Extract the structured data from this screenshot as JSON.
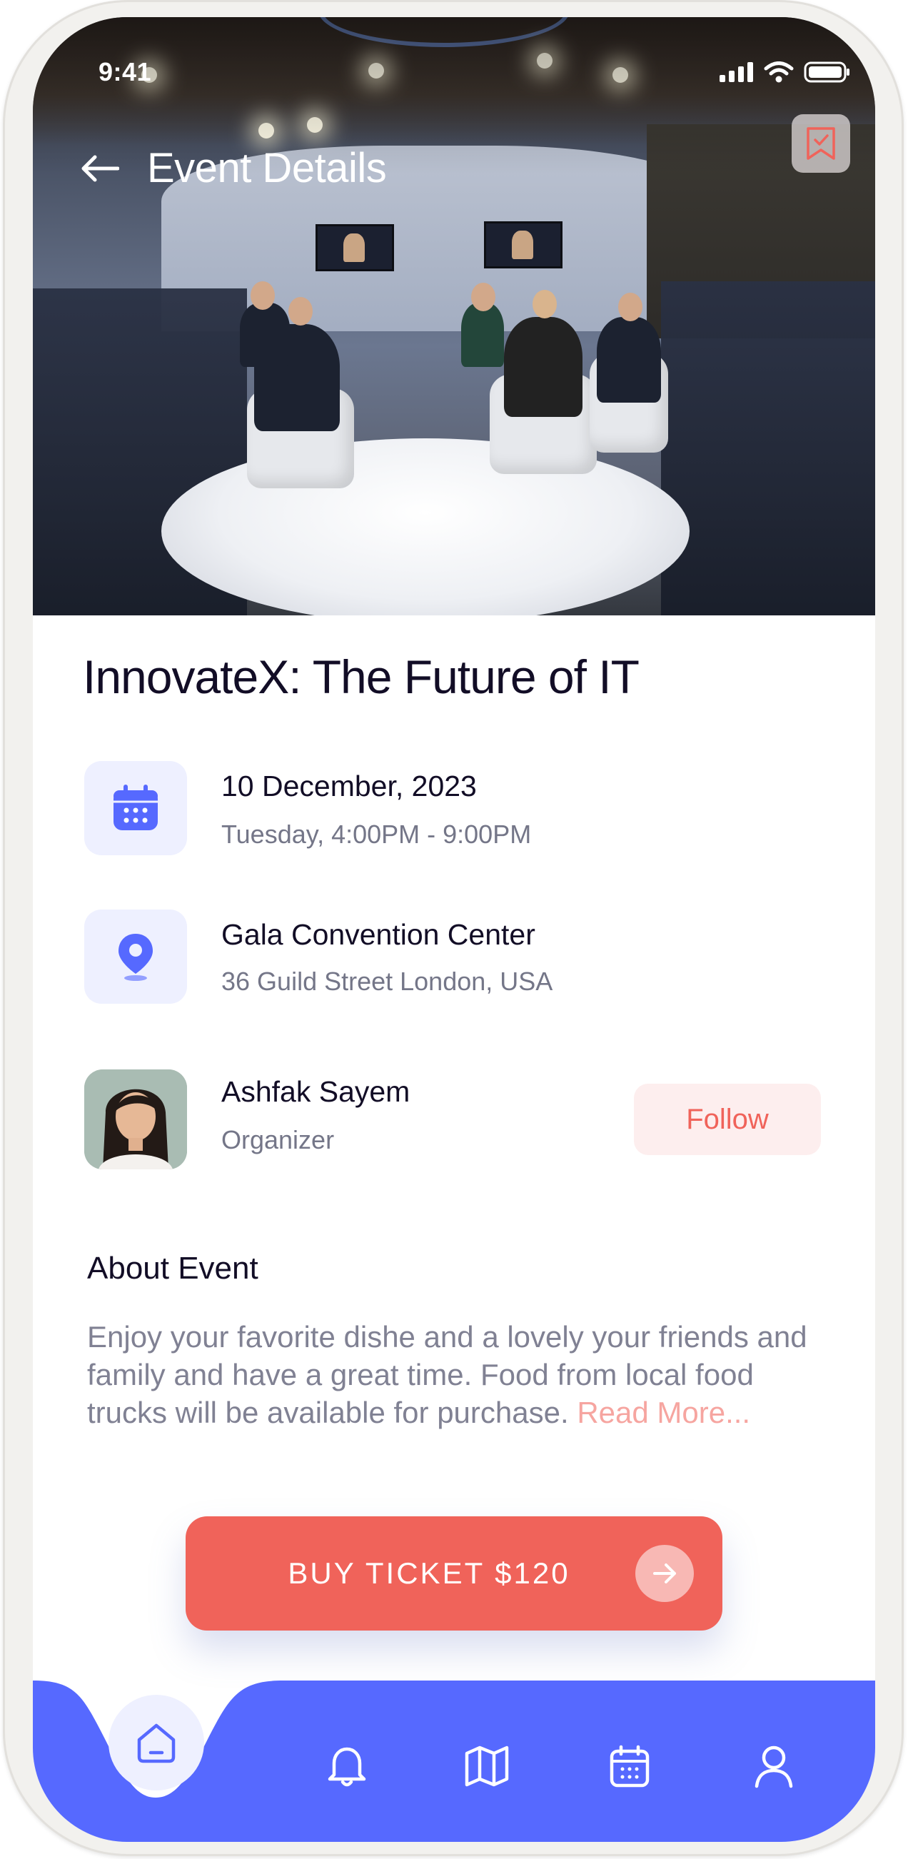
{
  "status_bar": {
    "time": "9:41"
  },
  "header": {
    "title": "Event Details"
  },
  "event": {
    "title": "InnovateX: The Future of IT"
  },
  "date_info": {
    "date": "10  December, 2023",
    "time": "Tuesday, 4:00PM - 9:00PM"
  },
  "location_info": {
    "venue": "Gala Convention Center",
    "address": "36 Guild Street London, USA"
  },
  "organizer": {
    "name": "Ashfak Sayem",
    "role": "Organizer",
    "follow_label": "Follow"
  },
  "about": {
    "heading": "About Event",
    "text": "Enjoy your favorite dishe and a lovely your friends and family and have a great time. Food from local food trucks will be available for purchase. ",
    "read_more": "Read More..."
  },
  "buy_button": {
    "label": "BUY TICKET $120"
  },
  "bottom_nav": {
    "items": [
      "home-icon",
      "bell-icon",
      "map-icon",
      "calendar-icon",
      "user-icon"
    ],
    "active": "home-icon"
  },
  "colors": {
    "accent": "#5669ff",
    "cta": "#f0635a",
    "title": "#120d26",
    "muted": "#747688",
    "icon_bg": "#eef0ff"
  }
}
